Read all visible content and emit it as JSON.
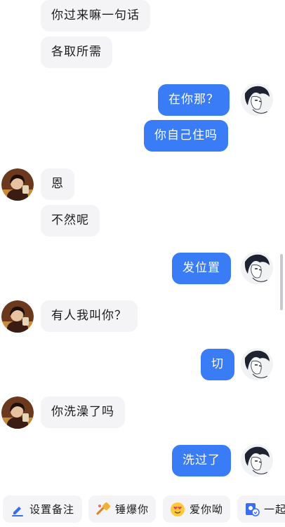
{
  "messages": [
    {
      "side": "in",
      "text": "你过来嘛一句话"
    },
    {
      "side": "in",
      "text": "各取所需"
    },
    {
      "side": "out",
      "text": "在你那？"
    },
    {
      "side": "out",
      "text": "你自己住吗"
    },
    {
      "side": "in",
      "text": "恩"
    },
    {
      "side": "in",
      "text": "不然呢"
    },
    {
      "side": "out",
      "text": "发位置"
    },
    {
      "side": "in",
      "text": "有人我叫你？"
    },
    {
      "side": "out",
      "text": "切"
    },
    {
      "side": "in",
      "text": "你洗澡了吗"
    },
    {
      "side": "out",
      "text": "洗过了"
    }
  ],
  "quick_actions": [
    {
      "label": "设置备注",
      "icon": "pencil-icon"
    },
    {
      "label": "锤爆你",
      "icon": "hammer-icon"
    },
    {
      "label": "爱你呦",
      "icon": "heart-eyes-emoji-icon"
    },
    {
      "label": "一起",
      "icon": "profile-card-icon"
    }
  ],
  "colors": {
    "outgoing_bubble": "#3a7cf5",
    "incoming_bubble": "#f4f4f6",
    "accent_icon": "#3a6ef0"
  }
}
